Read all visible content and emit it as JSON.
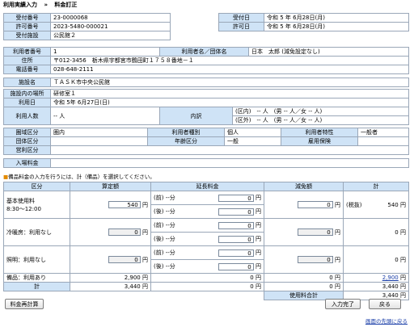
{
  "breadcrumb": {
    "parent": "利用実績入力",
    "sep": "»",
    "current": "料金訂正"
  },
  "info": {
    "l_accept_no": "受付番号",
    "accept_no": "23-0000068",
    "l_accept_date": "受付日",
    "accept_date": "令和 5 年 6月28日(月)",
    "l_permit_no": "許可番号",
    "permit_no": "2023-5480-000021",
    "l_permit_date": "許可日",
    "permit_date": "令和 5 年 6月28日(月)",
    "l_facility": "受付施設",
    "facility": "公民館２"
  },
  "user": {
    "l_user_no": "利用者番号",
    "user_no": "1",
    "l_user_name": "利用者名／団体名",
    "user_name": "日本　太郎 (減免設定なし)",
    "l_address": "住所",
    "address": "〒012-3456　栃木県宇都宮市鶴田町１７５８番地－１",
    "l_phone": "電話番号",
    "phone": "028-648-2111"
  },
  "facility": {
    "label": "施設名",
    "value": "ＴＡＳＫ市中央公民館"
  },
  "usage": {
    "l_place": "施設内の場所",
    "place": "研修室１",
    "l_date": "利用日",
    "date": "令和 5年 6月27日(日)",
    "l_count": "利用人数",
    "count": "-- 人",
    "l_detail": "内訳",
    "detail1": "(区内)　-- 人　(男 -- 人／女 -- 人)",
    "detail2": "(区外)　-- 人　(男 -- 人／女 -- 人)"
  },
  "classes": {
    "l_area": "圏域区分",
    "area": "圏内",
    "l_kind": "利用者種別",
    "kind": "個人",
    "l_attr": "利用者特性",
    "attr": "一般者",
    "l_group": "団体区分",
    "l_age": "年齢区分",
    "age": "一般",
    "l_emp": "雇用保険",
    "l_profit": "営利区分"
  },
  "deposit": {
    "label": "入場料金"
  },
  "note": "備品料金の入力を行うには、計（備品）を選択してください。",
  "fee": {
    "h_cat": "区分",
    "h_calc": "算定額",
    "h_ext": "延長料金",
    "h_red": "減免額",
    "h_total": "計",
    "rows": [
      {
        "name": "基本使用料",
        "time": "8:30～12:00",
        "calc": "540",
        "pre": "(前)",
        "post": "(後)",
        "min": "--分",
        "ext1": "0",
        "ext2": "0",
        "red": "0",
        "tax": "(税抜)",
        "total": "540"
      },
      {
        "name": "冷暖房：利用なし",
        "calc": "0",
        "pre": "(前)",
        "post": "(後)",
        "min": "--分",
        "ext1": "0",
        "ext2": "0",
        "red": "0",
        "total": "0"
      },
      {
        "name": "照明：利用なし",
        "calc": "0",
        "pre": "(前)",
        "post": "(後)",
        "min": "--分",
        "ext1": "0",
        "ext2": "0",
        "red": "0",
        "total": "0"
      }
    ],
    "equip_label": "備品：利用あり",
    "equip_calc": "2,900",
    "equip_ext": "0",
    "equip_red": "0",
    "equip_total": "2,900",
    "sum_label": "計",
    "sum_calc": "3,440",
    "sum_ext": "0",
    "sum_red": "0",
    "sum_total": "3,440",
    "grand_label": "使用料合計",
    "grand_total": "3,440",
    "yen": "円"
  },
  "buttons": {
    "recalc": "料金再計算",
    "done": "入力完了",
    "back": "戻る"
  },
  "footer_link": "画面の先頭に戻る"
}
